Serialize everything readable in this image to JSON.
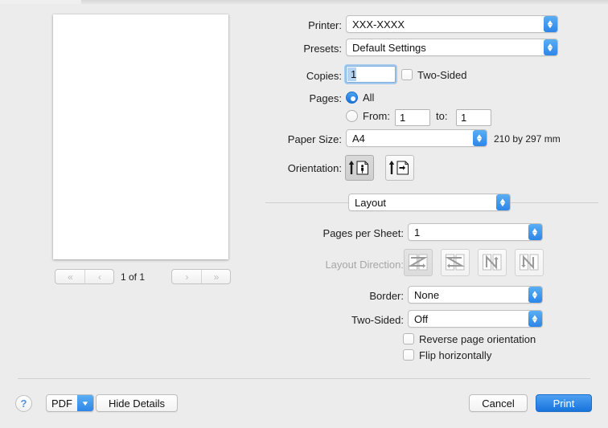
{
  "dialog": {
    "preview": {
      "page_indicator": "1 of 1",
      "nav": {
        "first": "«",
        "prev": "‹",
        "next": "›",
        "last": "»"
      }
    },
    "fields": {
      "printer_label": "Printer:",
      "printer_value": "XXX-XXXX",
      "presets_label": "Presets:",
      "presets_value": "Default Settings",
      "copies_label": "Copies:",
      "copies_value": "1",
      "two_sided_checkbox_label": "Two-Sided",
      "pages_label": "Pages:",
      "pages_all_label": "All",
      "pages_from_label": "From:",
      "pages_from_value": "1",
      "pages_to_label": "to:",
      "pages_to_value": "1",
      "paper_size_label": "Paper Size:",
      "paper_size_value": "A4",
      "paper_dimensions": "210 by 297 mm",
      "orientation_label": "Orientation:"
    },
    "pane": {
      "selected_pane": "Layout",
      "pages_per_sheet_label": "Pages per Sheet:",
      "pages_per_sheet_value": "1",
      "layout_direction_label": "Layout Direction:",
      "border_label": "Border:",
      "border_value": "None",
      "two_sided_label": "Two-Sided:",
      "two_sided_value": "Off",
      "reverse_page_orientation_label": "Reverse page orientation",
      "flip_horizontally_label": "Flip horizontally"
    },
    "buttons": {
      "help": "?",
      "pdf": "PDF",
      "hide_details": "Hide Details",
      "cancel": "Cancel",
      "print": "Print"
    },
    "colors": {
      "accent_blue": "#2d86e8",
      "primary_button": "#1874dd",
      "window_background": "#ececec",
      "separator": "#d0d0d0"
    }
  }
}
